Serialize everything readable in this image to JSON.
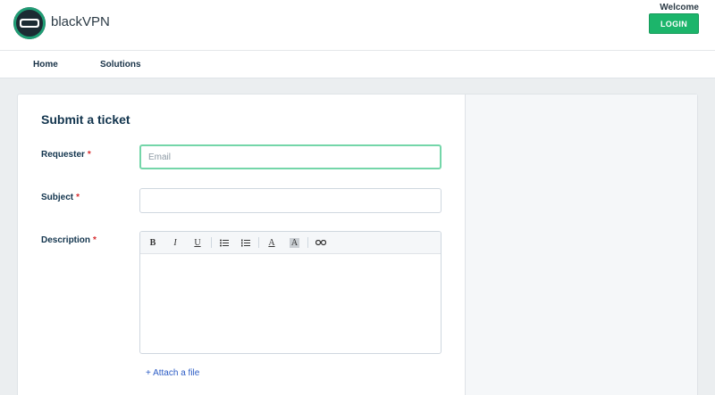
{
  "header": {
    "brand": "blackVPN",
    "welcome": "Welcome",
    "login_label": "LOGIN"
  },
  "nav": {
    "items": [
      {
        "label": "Home"
      },
      {
        "label": "Solutions"
      }
    ]
  },
  "form": {
    "title": "Submit a ticket",
    "requester": {
      "label": "Requester",
      "placeholder": "Email",
      "value": ""
    },
    "subject": {
      "label": "Subject",
      "value": ""
    },
    "description": {
      "label": "Description",
      "toolbar": {
        "bold": "B",
        "italic": "I",
        "underline": "U",
        "font_color": "A",
        "bg_color": "A"
      }
    },
    "required_mark": "*",
    "attach_label": "+ Attach a file"
  },
  "colors": {
    "accent_green": "#1cb56b",
    "focus_border": "#74d6a9",
    "required_red": "#d72d30",
    "link_blue": "#2c5cc5"
  }
}
